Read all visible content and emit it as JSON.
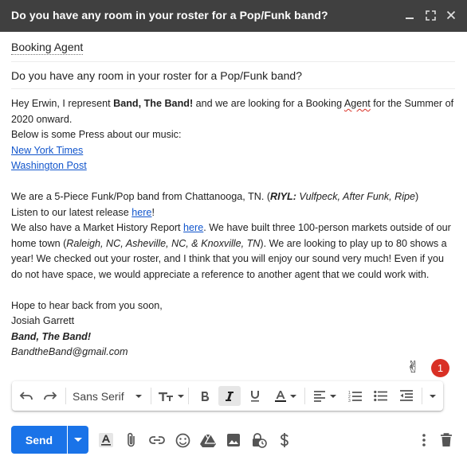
{
  "window": {
    "title": "Do you have any room in your roster for a Pop/Funk band?",
    "minimize_icon": "minimize-icon",
    "expand_icon": "fullscreen-icon",
    "close_icon": "close-icon"
  },
  "to": {
    "recipient": "Booking Agent"
  },
  "subject": {
    "value": "Do you have any room in your roster for a Pop/Funk band?"
  },
  "body": {
    "l1a": "Hey Erwin, I represent ",
    "l1b": "Band, The Band!",
    "l1c": " and we are looking for a Booking ",
    "l1d": "Agent",
    "l1e": " for the Summer of 2020 onward.",
    "l2": "Below is some Press about our music:",
    "link1": "New York Times",
    "link2": "Washington Post",
    "p2a": "We are a 5-Piece Funk/Pop band from Chattanooga, TN. (",
    "p2b": "RIYL:",
    "p2c": " Vulfpeck, After Funk, Ripe",
    "p2d": ")",
    "p3a": "Listen to our latest release ",
    "p3link": "here",
    "p3b": "!",
    "p4a": "We also have a Market History Report ",
    "p4link": "here",
    "p4b": ". We have built three 100-person markets outside of our home town (",
    "p4c": "Raleigh, NC, Asheville, NC, & Knoxville, TN",
    "p4d": "). We are looking to play up to 80 shows a year! We checked out your roster, and I think that you will enjoy our sound very much! Even if you do not have space, we would appreciate a reference to another agent that we could work with.",
    "closing": "Hope to hear back from you soon,",
    "sig_name": "Josiah Garrett",
    "sig_band": "Band, The Band!",
    "sig_email": "BandtheBand@gmail.com"
  },
  "emoji": {
    "glyph": "✌",
    "badge_count": "1"
  },
  "format_toolbar": {
    "font": "Sans Serif",
    "icons": [
      "undo-icon",
      "redo-icon",
      "font-size-icon",
      "bold-icon",
      "italic-icon",
      "underline-icon",
      "text-color-icon",
      "align-icon",
      "numbered-list-icon",
      "bulleted-list-icon",
      "indent-less-icon",
      "more-formatting-icon"
    ],
    "italic_active": true
  },
  "bottom": {
    "send_label": "Send",
    "icons": [
      "formatting-options-icon",
      "attach-icon",
      "link-icon",
      "emoji-icon",
      "drive-icon",
      "photo-icon",
      "confidential-icon",
      "money-icon",
      "more-options-icon",
      "discard-icon"
    ]
  },
  "colors": {
    "accent": "#1a73e8",
    "titlebar": "#404040",
    "link": "#1155cc",
    "badge": "#d93025"
  }
}
